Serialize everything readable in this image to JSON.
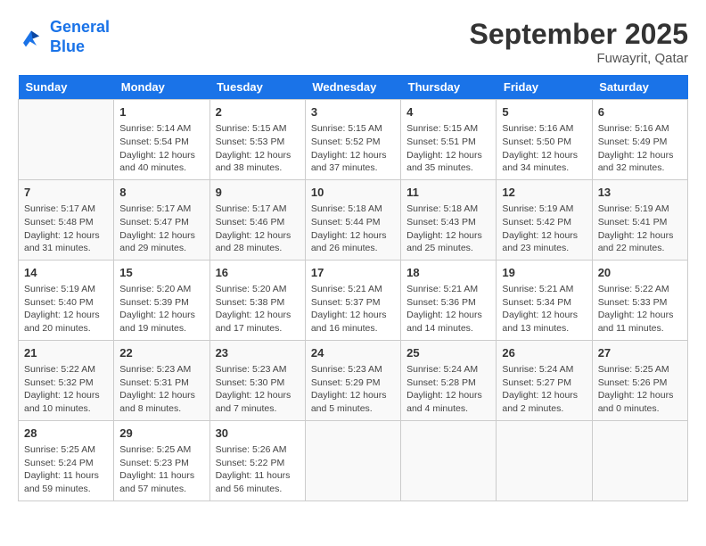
{
  "header": {
    "logo_line1": "General",
    "logo_line2": "Blue",
    "month_year": "September 2025",
    "location": "Fuwayrit, Qatar"
  },
  "days_of_week": [
    "Sunday",
    "Monday",
    "Tuesday",
    "Wednesday",
    "Thursday",
    "Friday",
    "Saturday"
  ],
  "weeks": [
    [
      {
        "date": "",
        "info": ""
      },
      {
        "date": "1",
        "info": "Sunrise: 5:14 AM\nSunset: 5:54 PM\nDaylight: 12 hours\nand 40 minutes."
      },
      {
        "date": "2",
        "info": "Sunrise: 5:15 AM\nSunset: 5:53 PM\nDaylight: 12 hours\nand 38 minutes."
      },
      {
        "date": "3",
        "info": "Sunrise: 5:15 AM\nSunset: 5:52 PM\nDaylight: 12 hours\nand 37 minutes."
      },
      {
        "date": "4",
        "info": "Sunrise: 5:15 AM\nSunset: 5:51 PM\nDaylight: 12 hours\nand 35 minutes."
      },
      {
        "date": "5",
        "info": "Sunrise: 5:16 AM\nSunset: 5:50 PM\nDaylight: 12 hours\nand 34 minutes."
      },
      {
        "date": "6",
        "info": "Sunrise: 5:16 AM\nSunset: 5:49 PM\nDaylight: 12 hours\nand 32 minutes."
      }
    ],
    [
      {
        "date": "7",
        "info": "Sunrise: 5:17 AM\nSunset: 5:48 PM\nDaylight: 12 hours\nand 31 minutes."
      },
      {
        "date": "8",
        "info": "Sunrise: 5:17 AM\nSunset: 5:47 PM\nDaylight: 12 hours\nand 29 minutes."
      },
      {
        "date": "9",
        "info": "Sunrise: 5:17 AM\nSunset: 5:46 PM\nDaylight: 12 hours\nand 28 minutes."
      },
      {
        "date": "10",
        "info": "Sunrise: 5:18 AM\nSunset: 5:44 PM\nDaylight: 12 hours\nand 26 minutes."
      },
      {
        "date": "11",
        "info": "Sunrise: 5:18 AM\nSunset: 5:43 PM\nDaylight: 12 hours\nand 25 minutes."
      },
      {
        "date": "12",
        "info": "Sunrise: 5:19 AM\nSunset: 5:42 PM\nDaylight: 12 hours\nand 23 minutes."
      },
      {
        "date": "13",
        "info": "Sunrise: 5:19 AM\nSunset: 5:41 PM\nDaylight: 12 hours\nand 22 minutes."
      }
    ],
    [
      {
        "date": "14",
        "info": "Sunrise: 5:19 AM\nSunset: 5:40 PM\nDaylight: 12 hours\nand 20 minutes."
      },
      {
        "date": "15",
        "info": "Sunrise: 5:20 AM\nSunset: 5:39 PM\nDaylight: 12 hours\nand 19 minutes."
      },
      {
        "date": "16",
        "info": "Sunrise: 5:20 AM\nSunset: 5:38 PM\nDaylight: 12 hours\nand 17 minutes."
      },
      {
        "date": "17",
        "info": "Sunrise: 5:21 AM\nSunset: 5:37 PM\nDaylight: 12 hours\nand 16 minutes."
      },
      {
        "date": "18",
        "info": "Sunrise: 5:21 AM\nSunset: 5:36 PM\nDaylight: 12 hours\nand 14 minutes."
      },
      {
        "date": "19",
        "info": "Sunrise: 5:21 AM\nSunset: 5:34 PM\nDaylight: 12 hours\nand 13 minutes."
      },
      {
        "date": "20",
        "info": "Sunrise: 5:22 AM\nSunset: 5:33 PM\nDaylight: 12 hours\nand 11 minutes."
      }
    ],
    [
      {
        "date": "21",
        "info": "Sunrise: 5:22 AM\nSunset: 5:32 PM\nDaylight: 12 hours\nand 10 minutes."
      },
      {
        "date": "22",
        "info": "Sunrise: 5:23 AM\nSunset: 5:31 PM\nDaylight: 12 hours\nand 8 minutes."
      },
      {
        "date": "23",
        "info": "Sunrise: 5:23 AM\nSunset: 5:30 PM\nDaylight: 12 hours\nand 7 minutes."
      },
      {
        "date": "24",
        "info": "Sunrise: 5:23 AM\nSunset: 5:29 PM\nDaylight: 12 hours\nand 5 minutes."
      },
      {
        "date": "25",
        "info": "Sunrise: 5:24 AM\nSunset: 5:28 PM\nDaylight: 12 hours\nand 4 minutes."
      },
      {
        "date": "26",
        "info": "Sunrise: 5:24 AM\nSunset: 5:27 PM\nDaylight: 12 hours\nand 2 minutes."
      },
      {
        "date": "27",
        "info": "Sunrise: 5:25 AM\nSunset: 5:26 PM\nDaylight: 12 hours\nand 0 minutes."
      }
    ],
    [
      {
        "date": "28",
        "info": "Sunrise: 5:25 AM\nSunset: 5:24 PM\nDaylight: 11 hours\nand 59 minutes."
      },
      {
        "date": "29",
        "info": "Sunrise: 5:25 AM\nSunset: 5:23 PM\nDaylight: 11 hours\nand 57 minutes."
      },
      {
        "date": "30",
        "info": "Sunrise: 5:26 AM\nSunset: 5:22 PM\nDaylight: 11 hours\nand 56 minutes."
      },
      {
        "date": "",
        "info": ""
      },
      {
        "date": "",
        "info": ""
      },
      {
        "date": "",
        "info": ""
      },
      {
        "date": "",
        "info": ""
      }
    ]
  ]
}
